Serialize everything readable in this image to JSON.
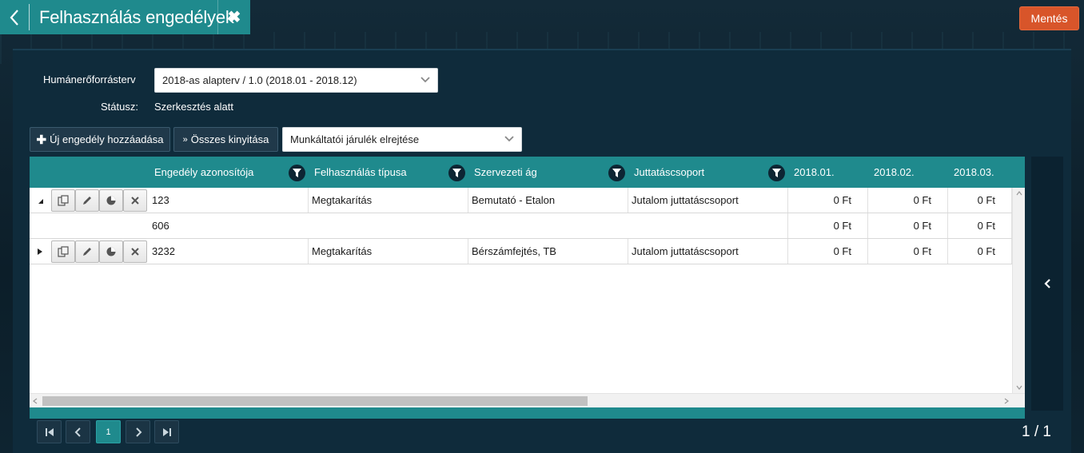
{
  "header": {
    "title": "Felhasználás engedélyek",
    "save_label": "Mentés"
  },
  "form": {
    "plan_label": "Humánerőforrásterv",
    "plan_value": "2018-as alapterv / 1.0 (2018.01 - 2018.12)",
    "status_label": "Státusz:",
    "status_value": "Szerkesztés alatt"
  },
  "toolbar": {
    "add_label": "Új engedély hozzáadása",
    "expand_label": "Összes kinyitása",
    "hide_select_value": "Munkáltatói járulék elrejtése"
  },
  "grid": {
    "columns": [
      "Engedély azonosítója",
      "Felhasználás típusa",
      "Szervezeti ág",
      "Juttatáscsoport",
      "2018.01.",
      "2018.02.",
      "2018.03."
    ],
    "rows": [
      {
        "expanded": true,
        "id": "123",
        "type": "Megtakarítás",
        "org": "Bemutató - Etalon",
        "group": "Jutalom juttatáscsoport",
        "m1": "0 Ft",
        "m2": "0 Ft",
        "m3": "0 Ft"
      },
      {
        "child": true,
        "id": "606",
        "type": "",
        "org": "",
        "group": "",
        "m1": "0 Ft",
        "m2": "0 Ft",
        "m3": "0 Ft"
      },
      {
        "expanded": false,
        "id": "3232",
        "type": "Megtakarítás",
        "org": "Bérszámfejtés, TB",
        "group": "Jutalom juttatáscsoport",
        "m1": "0 Ft",
        "m2": "0 Ft",
        "m3": "0 Ft"
      }
    ]
  },
  "pager": {
    "current_page": "1",
    "page_info": "1 / 1"
  },
  "colors": {
    "accent": "#1f8a8d",
    "save": "#d8552a",
    "panel": "#0f2b3b"
  }
}
